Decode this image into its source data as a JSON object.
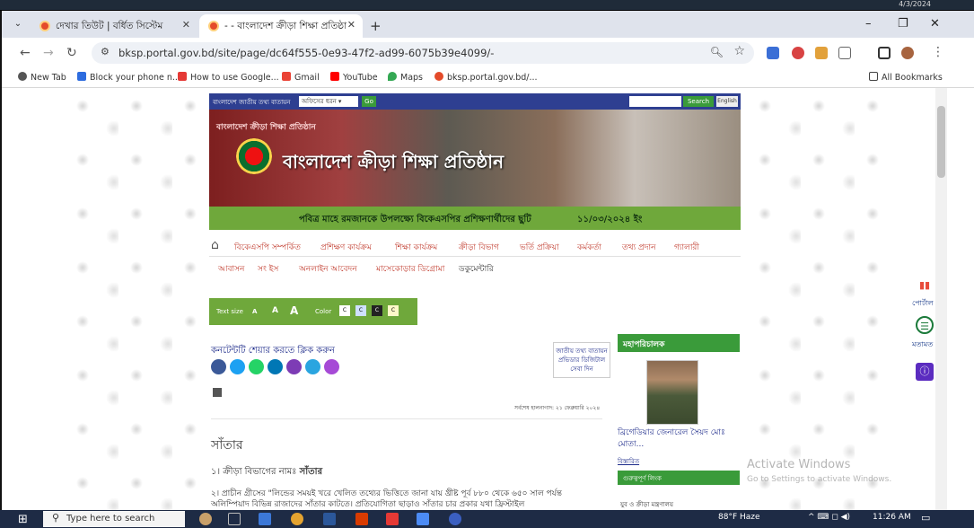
{
  "top_strip": {
    "date": "4/3/2024"
  },
  "tabs": [
    {
      "title": "দেখার তিউট | বর্ধিত সিস্টেম",
      "active": false
    },
    {
      "title": "- - বাংলাদেশ ক্রীড়া শিক্ষা প্রতিষ্ঠা",
      "active": true
    }
  ],
  "browser": {
    "url": "bksp.portal.gov.bd/site/page/dc64f555-0e93-47f2-ad99-6075b39e4099/-",
    "new_tab": "+",
    "window_min": "–",
    "window_restore": "❐",
    "window_close": "✕"
  },
  "bookmarks": [
    {
      "label": "New Tab",
      "color": "#555555"
    },
    {
      "label": "Block your phone n...",
      "color": "#2d6cdf"
    },
    {
      "label": "How to use Google...",
      "color": "#e53935"
    },
    {
      "label": "Gmail",
      "color": "#ea4335"
    },
    {
      "label": "YouTube",
      "color": "#ff0000"
    },
    {
      "label": "Maps",
      "color": "#34a853"
    },
    {
      "label": "bksp.portal.gov.bd/...",
      "color": "#e44b2a"
    }
  ],
  "all_bookmarks": "All Bookmarks",
  "site": {
    "topbar_text": "বাংলাদেশ জাতীয় তথ্য বাতায়ন",
    "office_select": "অফিসের ধরন ▾",
    "go": "Go",
    "search_btn": "Search",
    "english_btn": "English",
    "banner_tagline": "বাংলাদেশ ক্রীড়া শিক্ষা প্রতিষ্ঠান",
    "banner_title": "বাংলাদেশ ক্রীড়া শিক্ষা প্রতিষ্ঠান",
    "ribbon_text": "পবিত্র মাহে রমজানকে উপলক্ষ্যে বিকেএসপির প্রশিক্ষণার্থীদের ছুটি",
    "ribbon_date": "১১/০৩/২০২৪ ইং",
    "menu_row1": [
      "বিকেএসপি সম্পর্কিত",
      "প্রশিক্ষণ কার্যক্রম",
      "শিক্ষা কার্যক্রম",
      "ক্রীড়া বিভাগ",
      "ভর্তি প্রক্রিয়া",
      "কর্মকর্তা",
      "তথ্য প্রদান",
      "গ্যালারী"
    ],
    "menu_row2": [
      "আবাসন",
      "সং ইস",
      "অনলাইন আবেদন",
      "মাসেকোড়ার ডিগ্রোমা",
      "ডকুমেন্টারি"
    ],
    "text_size_label": "Text size",
    "text_size_a1": "A",
    "text_size_a2": "A",
    "text_size_a3": "A",
    "color_label": "Color",
    "color_boxes": [
      "C",
      "C",
      "C",
      "C"
    ],
    "contact_link": "কনটেন্টটি শেয়ার করতে ক্লিক করুন",
    "notice_box": "জাতীয় তথ্য বাতায়ন প্রভিডার ডিজিটাল সেবা দিন",
    "updated": "সর্বশেষ হালনাগাদ: ২১ ফেব্রুয়ারি ২০২৪",
    "page_title": "সাঁতার",
    "p1_label": "১। ক্রীড়া বিভাগের নামঃ",
    "p1_value": "সাঁতার",
    "p2": "২। প্রাচীন গ্রীসের \"লিন্ডের সময়ই খরে খেলিত তথ্যের ভিত্তিতে জানা যায় খ্রীষ্ট পূর্ব ৮৮০ থেকে ৬৫০ সাল পর্যন্ত অলিম্পিয়াদ বিভিন্ন রাজাদের সাঁতার কাটতে। প্রতিযোগিতা ছাড়াও সাঁতার চার প্রকার যথা ফ্রিস্টাইল",
    "sidebar_head": "মহাপরিচালক",
    "director_name": "ব্রিগেডিয়ার জেনারেল সৈয়দ মোঃ মোতা...",
    "director_more": "বিস্তারিত",
    "sidebar_head2": "গুরুত্বপূর্ণ লিংক",
    "sidebar_li": "যুব ও ক্রীড়া মন্ত্রণালয়",
    "right_labels": [
      "পোর্টাল",
      "মতামত"
    ]
  },
  "watermark": {
    "line1": "Activate Windows",
    "line2": "Go to Settings to activate Windows."
  },
  "taskbar": {
    "search_placeholder": "Type here to search",
    "weather": "88°F  Haze",
    "time": "11:26 AM",
    "tray_icons": "^ ⌨ ◻ ◀)"
  }
}
